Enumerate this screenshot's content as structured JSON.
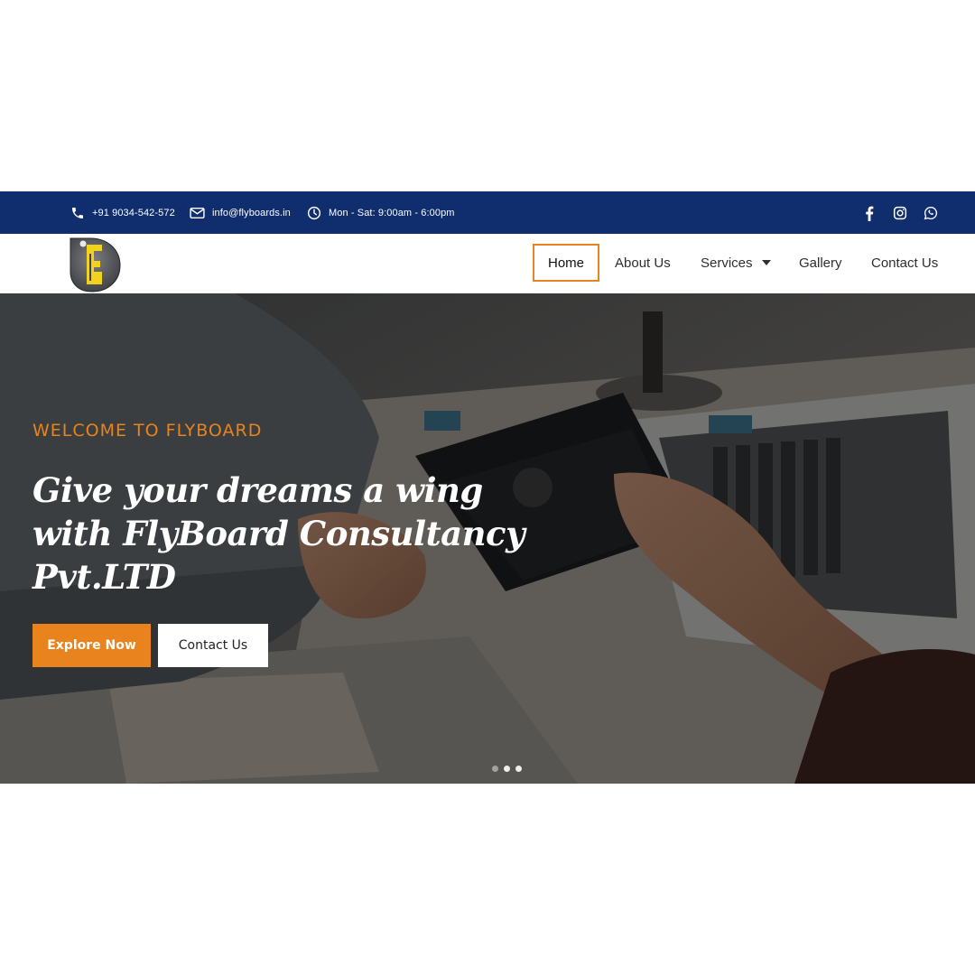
{
  "topbar": {
    "phone": "+91 9034-542-572",
    "email": "info@flyboards.in",
    "hours": "Mon - Sat: 9:00am - 6:00pm",
    "background": "#102e6e",
    "social_icons": [
      "facebook-icon",
      "instagram-icon",
      "whatsapp-icon"
    ]
  },
  "nav": {
    "items": [
      {
        "label": "Home",
        "active": true
      },
      {
        "label": "About Us"
      },
      {
        "label": "Services",
        "dropdown": true
      },
      {
        "label": "Gallery"
      },
      {
        "label": "Contact Us"
      }
    ],
    "accent": "#e8831d"
  },
  "hero": {
    "eyebrow": "WELCOME TO FLYBOARD",
    "headline_lines": [
      "Give your dreams a wing",
      "with FlyBoard Consultancy",
      "Pvt.LTD"
    ],
    "primary_button": "Explore Now",
    "secondary_button": "Contact Us",
    "slides": 3,
    "active_slide": 2
  },
  "colors": {
    "accent": "#e8831d",
    "navy": "#102e6e"
  }
}
